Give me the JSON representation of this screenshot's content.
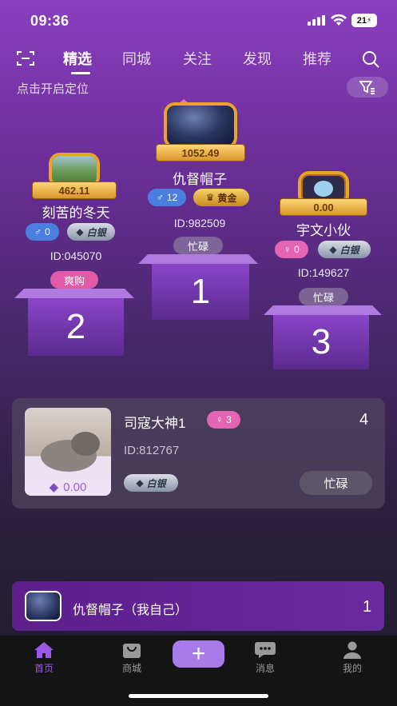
{
  "status_bar": {
    "time": "09:36",
    "battery": "21"
  },
  "nav": {
    "tabs": [
      "精选",
      "同城",
      "关注",
      "发现",
      "推荐"
    ],
    "active_tab": "精选"
  },
  "location_prompt": "点击开启定位",
  "podium": [
    {
      "rank": "1",
      "name": "仇督帽子",
      "score": "1052.49",
      "gender_count": "12",
      "gender": "male",
      "level": "黄金",
      "id": "ID:982509",
      "status": "忙碌"
    },
    {
      "rank": "2",
      "name": "刻苦的冬天",
      "score": "462.11",
      "gender_count": "0",
      "gender": "male",
      "level": "白银",
      "id": "ID:045070",
      "status": "爽购"
    },
    {
      "rank": "3",
      "name": "宇文小伙",
      "score": "0.00",
      "gender_count": "0",
      "gender": "female",
      "level": "白银",
      "id": "ID:149627",
      "status": "忙碌"
    }
  ],
  "list": [
    {
      "rank": "4",
      "name": "司寇大神1",
      "gender_count": "3",
      "gender": "female",
      "id": "ID:812767",
      "price": "0.00",
      "level": "白银",
      "status": "忙碌"
    }
  ],
  "self": {
    "name": "仇督帽子（我自己）",
    "rank": "1"
  },
  "tabbar": {
    "items": [
      "首页",
      "商城",
      "消息",
      "我的"
    ],
    "active": "首页"
  },
  "colors": {
    "accent": "#9b57e6",
    "gold": "#e9a52a",
    "female": "#e365b4",
    "male": "#4a7fe0"
  }
}
